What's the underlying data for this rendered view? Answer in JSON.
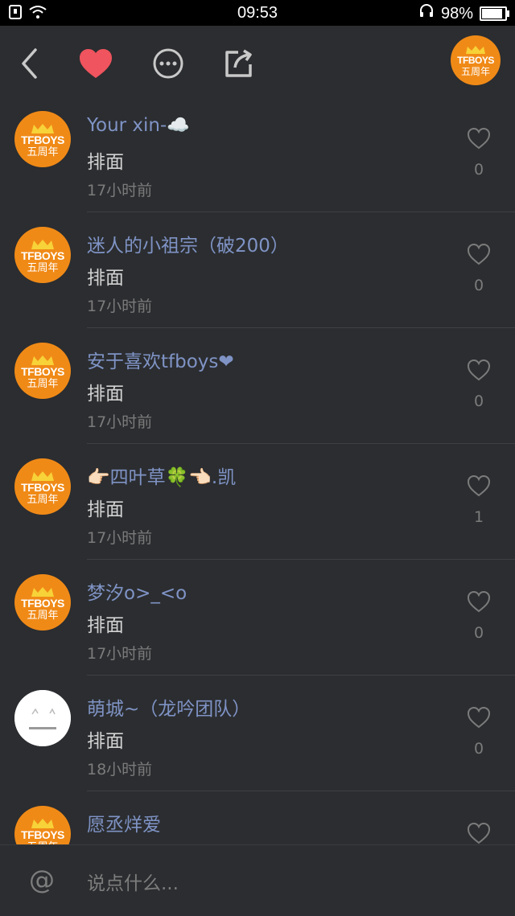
{
  "status": {
    "time": "09:53",
    "battery": "98%",
    "battery_level": 0.98
  },
  "toolbar": {
    "back": "back-icon",
    "favorite": "heart-icon",
    "more": "more-icon",
    "share": "share-icon"
  },
  "avatar_text": {
    "line1": "TFBOYS",
    "line2": "五周年"
  },
  "comments": [
    {
      "name": "Your xin-☁️",
      "content": "排面",
      "time": "17小时前",
      "likes": "0",
      "avatar": "orange"
    },
    {
      "name": "迷人的小祖宗（破200）",
      "content": "排面",
      "time": "17小时前",
      "likes": "0",
      "avatar": "orange"
    },
    {
      "name": "安于喜欢tfboys❤",
      "content": "排面",
      "time": "17小时前",
      "likes": "0",
      "avatar": "orange"
    },
    {
      "name": "👉🏻四叶草🍀👈🏻.凯",
      "content": "排面",
      "time": "17小时前",
      "likes": "1",
      "avatar": "orange"
    },
    {
      "name": "梦汐o>_<o",
      "content": "排面",
      "time": "17小时前",
      "likes": "0",
      "avatar": "orange"
    },
    {
      "name": "萌城~（龙吟团队）",
      "content": "排面",
      "time": "18小时前",
      "likes": "0",
      "avatar": "white"
    },
    {
      "name": "愿丞烊爱",
      "content": "",
      "time": "",
      "likes": "",
      "avatar": "orange"
    }
  ],
  "input": {
    "at": "@",
    "placeholder": "说点什么..."
  },
  "colors": {
    "accent_heart": "#f0545e",
    "avatar_bg": "#f08a17",
    "name": "#7f93c5"
  }
}
